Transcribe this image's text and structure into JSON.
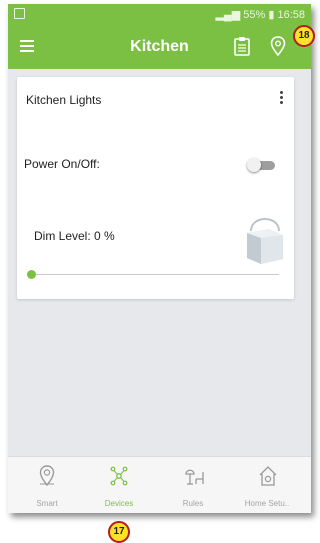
{
  "status_bar": {
    "battery": "55%",
    "time": "16:58"
  },
  "app_bar": {
    "title": "Kitchen"
  },
  "device_card": {
    "title": "Kitchen Lights",
    "power_label": "Power On/Off:",
    "power_on": false,
    "dim_label": "Dim Level: 0 %",
    "dim_level": 0
  },
  "bottom_nav": {
    "items": [
      {
        "label": "Smart",
        "icon": "location-pin-icon",
        "active": false
      },
      {
        "label": "Devices",
        "icon": "network-nodes-icon",
        "active": true
      },
      {
        "label": "Rules",
        "icon": "lamp-chair-icon",
        "active": false
      },
      {
        "label": "Home Setu..",
        "icon": "home-gear-icon",
        "active": false
      }
    ]
  },
  "annotations": {
    "badge_top": "18",
    "badge_bottom": "17"
  },
  "colors": {
    "accent": "#7bc043",
    "badge_fill": "#ffe12b",
    "badge_border": "#b31d1d"
  }
}
